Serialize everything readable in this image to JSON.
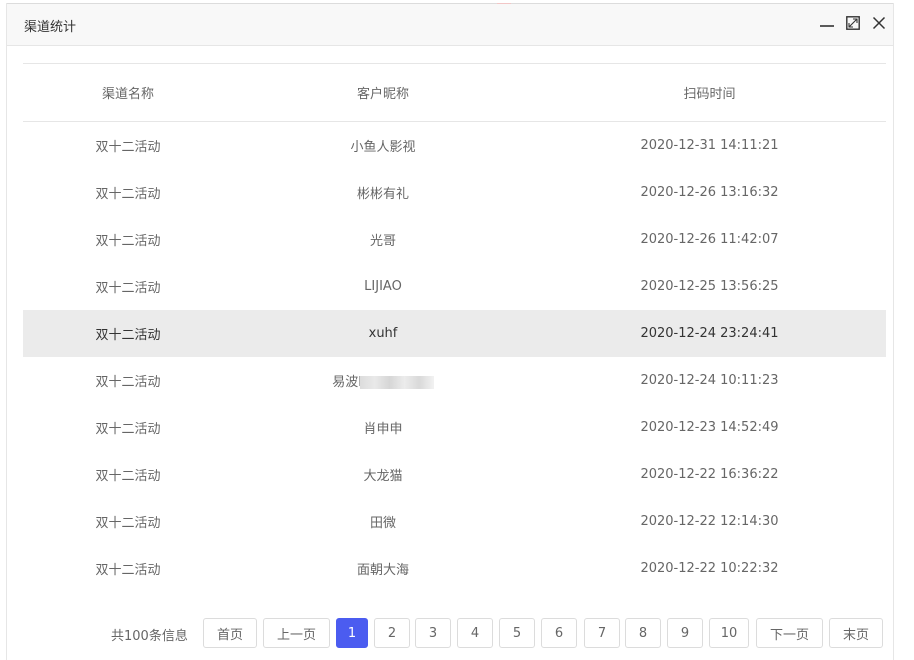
{
  "window": {
    "title": "渠道统计",
    "controls": [
      "minimize-icon",
      "maximize-icon",
      "close-icon"
    ]
  },
  "table": {
    "headers": [
      "渠道名称",
      "客户昵称",
      "扫码时间"
    ],
    "rows": [
      {
        "channel": "双十二活动",
        "nickname": "小鱼人影视",
        "time": "2020-12-31 14:11:21"
      },
      {
        "channel": "双十二活动",
        "nickname": "彬彬有礼",
        "time": "2020-12-26 13:16:32"
      },
      {
        "channel": "双十二活动",
        "nickname": "光哥",
        "time": "2020-12-26 11:42:07"
      },
      {
        "channel": "双十二活动",
        "nickname": "LIJIAO",
        "time": "2020-12-25 13:56:25"
      },
      {
        "channel": "双十二活动",
        "nickname": "xuhf",
        "time": "2020-12-24 23:24:41"
      },
      {
        "channel": "双十二活动",
        "nickname": "易波l",
        "time": "2020-12-24 10:11:23"
      },
      {
        "channel": "双十二活动",
        "nickname": "肖申申",
        "time": "2020-12-23 14:52:49"
      },
      {
        "channel": "双十二活动",
        "nickname": "大龙猫",
        "time": "2020-12-22 16:36:22"
      },
      {
        "channel": "双十二活动",
        "nickname": "田微",
        "time": "2020-12-22 12:14:30"
      },
      {
        "channel": "双十二活动",
        "nickname": "面朝大海",
        "time": "2020-12-22 10:22:32"
      }
    ]
  },
  "pagination": {
    "total_text": "共100条信息",
    "first": "首页",
    "prev": "上一页",
    "pages": [
      "1",
      "2",
      "3",
      "4",
      "5",
      "6",
      "7",
      "8",
      "9",
      "10"
    ],
    "current": "1",
    "next": "下一页",
    "last": "末页"
  },
  "colors": {
    "accent": "#4b5cf0",
    "row_highlight": "#ebebeb"
  }
}
